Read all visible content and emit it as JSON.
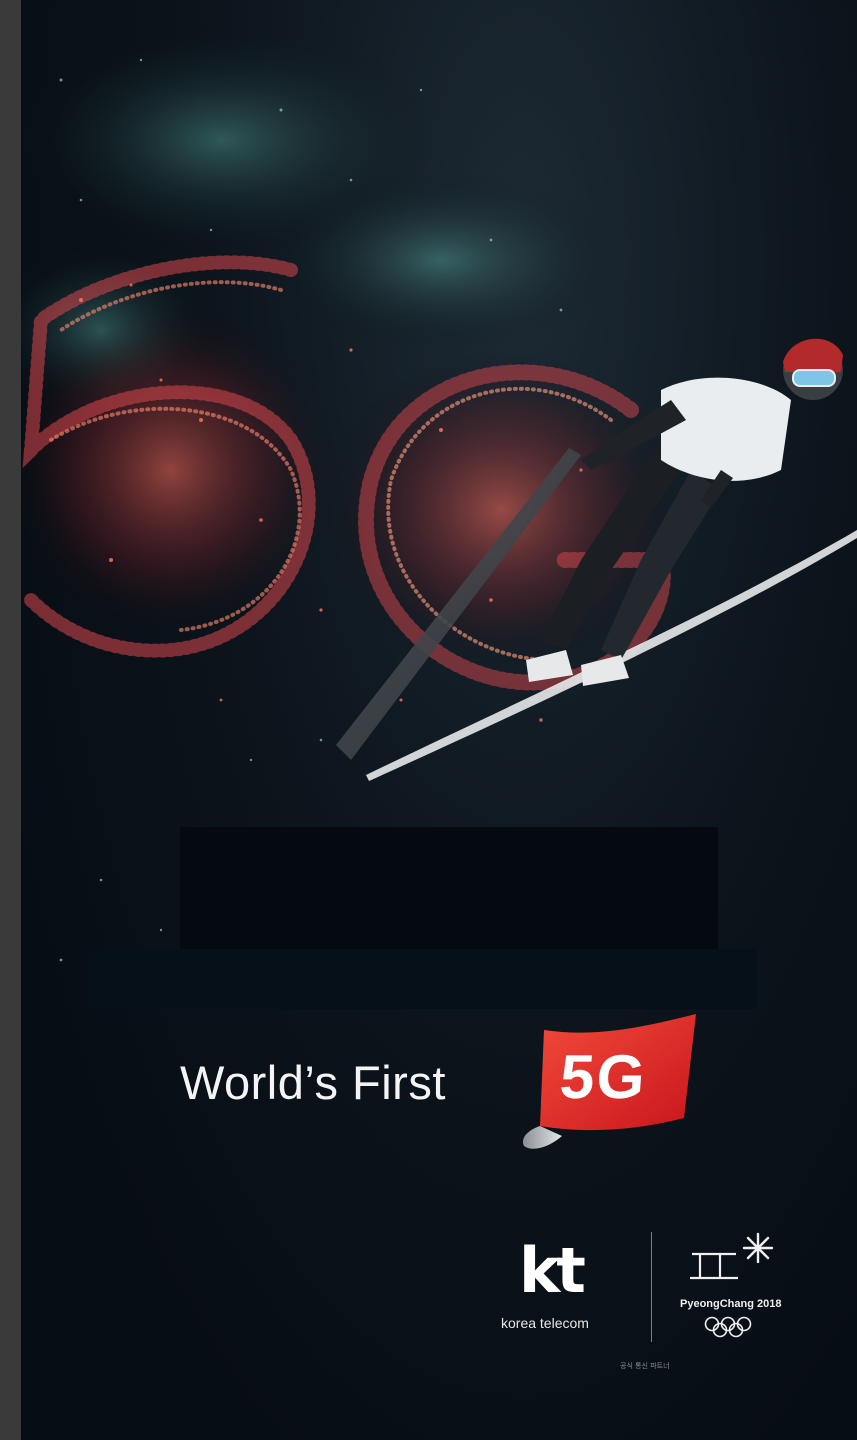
{
  "tagline": "World’s First",
  "badge": "5G",
  "brand": {
    "mark": "kt",
    "name": "korea telecom"
  },
  "event": {
    "name": "PyeongChang 2018",
    "emblem": "pyeongchang-emblem-icon",
    "rings": "olympic-rings-icon"
  },
  "partner_label": "공식 통신 파트너",
  "colors": {
    "background": "#070d14",
    "badge_red": "#e2231a",
    "particles_red": "#c8303a",
    "particles_teal": "#3fb3a8",
    "text": "#f4f4f4"
  }
}
